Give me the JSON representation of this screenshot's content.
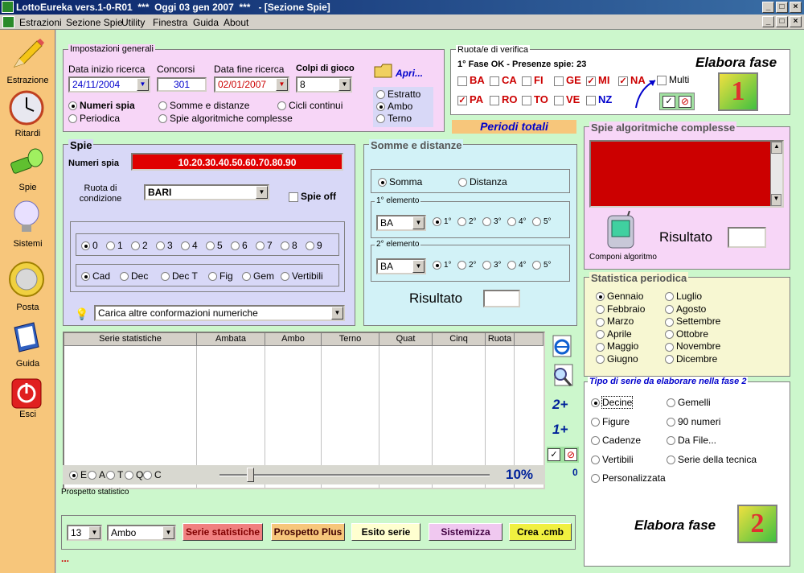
{
  "window": {
    "title": "LottoEureka vers.1-0-R01  ***  Oggi 03 gen 2007  ***   - [Sezione Spie]"
  },
  "menu": [
    "Estrazioni",
    "Sezione Spie",
    "Utility",
    "Finestra",
    "Guida",
    "About"
  ],
  "sidebar": [
    {
      "label": "Estrazione",
      "icon": "pencil-icon"
    },
    {
      "label": "Ritardi",
      "icon": "clock-icon"
    },
    {
      "label": "Spie",
      "icon": "flashlight-icon"
    },
    {
      "label": "Sistemi",
      "icon": "lightbulb-icon"
    },
    {
      "label": "Posta",
      "icon": "coin-icon"
    },
    {
      "label": "Guida",
      "icon": "book-icon"
    },
    {
      "label": "Esci",
      "icon": "power-icon"
    }
  ],
  "impostazioni": {
    "title": "Impostazioni generali",
    "data_inizio_label": "Data inizio ricerca",
    "data_inizio": "24/11/2004",
    "concorsi_label": "Concorsi",
    "concorsi": "301",
    "data_fine_label": "Data fine ricerca",
    "data_fine": "02/01/2007",
    "colpi_label": "Colpi di gioco",
    "colpi": "8",
    "apri": "Apri...",
    "modes": [
      "Numeri spia",
      "Somme e distanze",
      "Cicli continui",
      "Periodica",
      "Spie algoritmiche complesse"
    ],
    "play": [
      "Estratto",
      "Ambo",
      "Terno"
    ]
  },
  "ruota": {
    "title": "Ruota/e di verifica",
    "status": "1° Fase OK - Presenze spie: 23",
    "elabora1": "Elabora fase",
    "fase1": "1",
    "multi": "Multi",
    "wheels": [
      {
        "n": "BA",
        "c": false
      },
      {
        "n": "CA",
        "c": false
      },
      {
        "n": "FI",
        "c": false
      },
      {
        "n": "GE",
        "c": false
      },
      {
        "n": "MI",
        "c": true
      },
      {
        "n": "NA",
        "c": true
      },
      {
        "n": "PA",
        "c": true
      },
      {
        "n": "RO",
        "c": false
      },
      {
        "n": "TO",
        "c": false
      },
      {
        "n": "VE",
        "c": false
      },
      {
        "n": "NZ",
        "c": false
      }
    ]
  },
  "periodi": "Periodi totali",
  "spie": {
    "title": "Spie",
    "numeri_label": "Numeri spia",
    "numeri": "10.20.30.40.50.60.70.80.90",
    "ruota_label": "Ruota di condizione",
    "ruota": "BARI",
    "spie_off": "Spie off",
    "digits": [
      "0",
      "1",
      "2",
      "3",
      "4",
      "5",
      "6",
      "7",
      "8",
      "9"
    ],
    "types": [
      "Cad",
      "Dec",
      "Dec T",
      "Fig",
      "Gem",
      "Vertibili"
    ],
    "carica": "Carica altre conformazioni numeriche"
  },
  "somme": {
    "title": "Somme e distanze",
    "somma": "Somma",
    "distanza": "Distanza",
    "el1": "1° elemento",
    "el2": "2° elemento",
    "ruota": "BA",
    "pos": [
      "1°",
      "2°",
      "3°",
      "4°",
      "5°"
    ],
    "risultato": "Risultato"
  },
  "algo": {
    "title": "Spie algoritmiche complesse",
    "risultato": "Risultato",
    "componi": "Componi algoritmo"
  },
  "statistica": {
    "title": "Statistica periodica",
    "months": [
      "Gennaio",
      "Febbraio",
      "Marzo",
      "Aprile",
      "Maggio",
      "Giugno",
      "Luglio",
      "Agosto",
      "Settembre",
      "Ottobre",
      "Novembre",
      "Dicembre"
    ]
  },
  "tipo": {
    "title": "Tipo di serie da elaborare nella fase 2",
    "left": [
      "Decine",
      "Figure",
      "Cadenze",
      "Vertibili",
      "Personalizzata"
    ],
    "right": [
      "Gemelli",
      "90 numeri",
      "Da File...",
      "Serie della tecnica"
    ],
    "elabora2": "Elabora fase",
    "fase2": "2"
  },
  "table": {
    "headers": [
      "Serie statistiche",
      "Ambata",
      "Ambo",
      "Terno",
      "Quat",
      "Cinq",
      "Ruota"
    ]
  },
  "tools": {
    "plus2": "2+",
    "plus1": "1+",
    "zero": "0"
  },
  "slider": {
    "opts": [
      "E",
      "A",
      "T",
      "Q",
      "C"
    ],
    "pct": "10%",
    "prospetto": "Prospetto statistico"
  },
  "bottom": {
    "num": "13",
    "sorte": "Ambo",
    "buttons": [
      "Serie statistiche",
      "Prospetto Plus",
      "Esito serie",
      "Sistemizza",
      "Crea .cmb"
    ],
    "dots": "..."
  }
}
